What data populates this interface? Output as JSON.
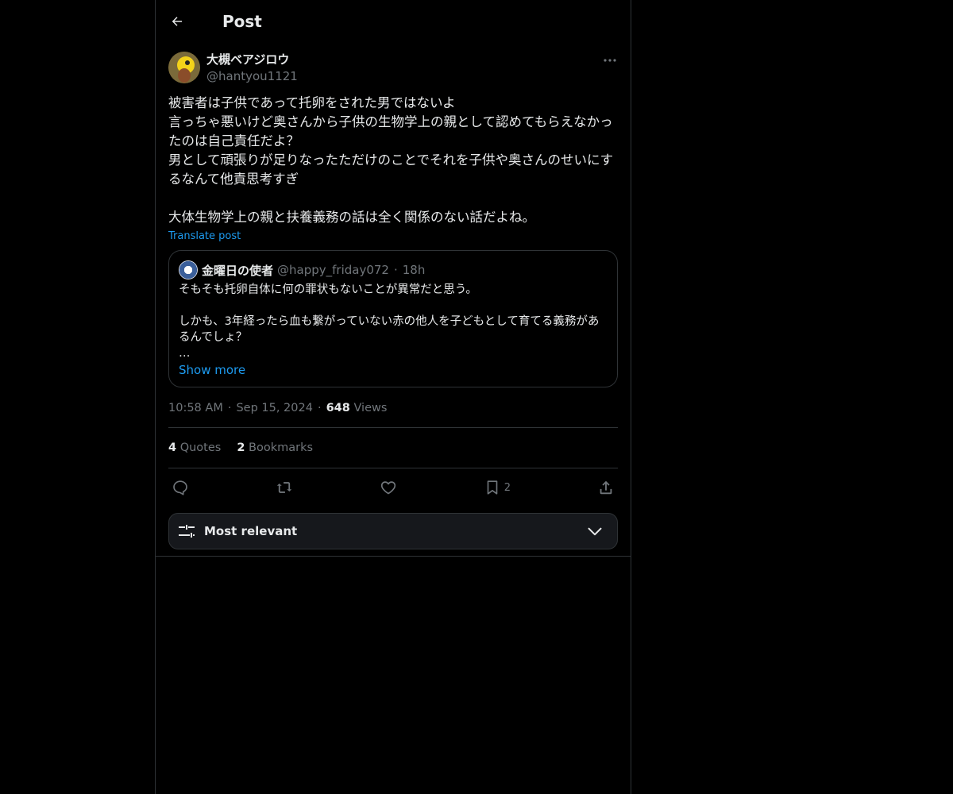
{
  "header": {
    "title": "Post",
    "back_icon": "arrow-left-icon"
  },
  "author": {
    "name": "大槻ベアジロウ",
    "handle": "@hantyou1121"
  },
  "post": {
    "text": "被害者は子供であって托卵をされた男ではないよ\n言っちゃ悪いけど奥さんから子供の生物学上の親として認めてもらえなかったのは自己責任だよ？\n男として頑張りが足りなったただけのことでそれを子供や奥さんのせいにするなんて他責思考すぎ\n\n大体生物学上の親と扶養義務の話は全く関係のない話だよね。",
    "translate_label": "Translate post"
  },
  "quote": {
    "name": "金曜日の使者",
    "handle": "@happy_friday072",
    "separator": "·",
    "time": "18h",
    "text": "そもそも托卵自体に何の罪状もないことが異常だと思う。\n\nしかも、3年経ったら血も繋がっていない赤の他人を子どもとして育てる義務があるんでしょ？\n…",
    "show_more": "Show more"
  },
  "meta": {
    "time": "10:58 AM",
    "separator": "·",
    "date": "Sep 15, 2024",
    "views_count": "648",
    "views_label": "Views"
  },
  "stats": {
    "quotes_count": "4",
    "quotes_label": "Quotes",
    "bookmarks_count": "2",
    "bookmarks_label": "Bookmarks"
  },
  "actions": {
    "reply_icon": "reply-icon",
    "repost_icon": "repost-icon",
    "like_icon": "heart-icon",
    "bookmark_icon": "bookmark-icon",
    "bookmark_count": "2",
    "share_icon": "share-icon"
  },
  "sort": {
    "label": "Most relevant"
  },
  "colors": {
    "background": "#000000",
    "text": "#e7e9ea",
    "muted": "#71767b",
    "accent": "#1d9bf0",
    "border": "#2f3336"
  }
}
